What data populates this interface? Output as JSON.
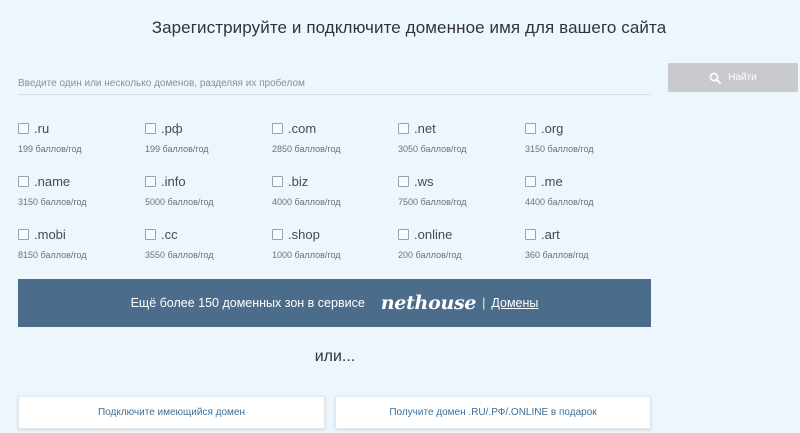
{
  "title": "Зарегистрируйте и подключите доменное имя для вашего сайта",
  "search": {
    "placeholder": "Введите один или несколько доменов, разделяя их пробелом",
    "button_label": "Найти",
    "button_icon": "search-icon"
  },
  "zones": [
    {
      "name": ".ru",
      "price": "199 баллов/год"
    },
    {
      "name": ".рф",
      "price": "199 баллов/год"
    },
    {
      "name": ".com",
      "price": "2850 баллов/год"
    },
    {
      "name": ".net",
      "price": "3050 баллов/год"
    },
    {
      "name": ".org",
      "price": "3150 баллов/год"
    },
    {
      "name": ".name",
      "price": "3150 баллов/год"
    },
    {
      "name": ".info",
      "price": "5000 баллов/год"
    },
    {
      "name": ".biz",
      "price": "4000 баллов/год"
    },
    {
      "name": ".ws",
      "price": "7500 баллов/год"
    },
    {
      "name": ".me",
      "price": "4400 баллов/год"
    },
    {
      "name": ".mobi",
      "price": "8150 баллов/год"
    },
    {
      "name": ".cc",
      "price": "3550 баллов/год"
    },
    {
      "name": ".shop",
      "price": "1000 баллов/год"
    },
    {
      "name": ".online",
      "price": "200 баллов/год"
    },
    {
      "name": ".art",
      "price": "360 баллов/год"
    }
  ],
  "banner": {
    "text": "Ещё более 150 доменных зон в сервисе",
    "logo": "nethouse",
    "separator": "|",
    "link": "Домены",
    "bg_color": "#4c6c8c"
  },
  "or_text": "или...",
  "actions": {
    "connect_existing": "Подключите имеющийся домен",
    "get_gift": "Получите домен .RU/.РФ/.ONLINE в подарок"
  },
  "colors": {
    "background": "#eef6fd",
    "search_button": "#c8cacd",
    "action_text": "#3f6f96"
  }
}
